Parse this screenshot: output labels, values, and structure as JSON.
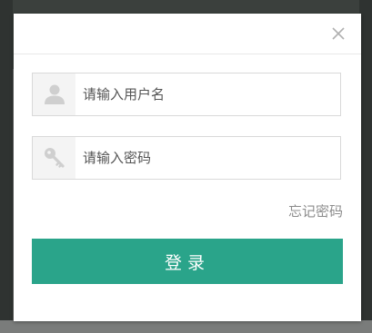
{
  "dialog": {
    "close_icon": "close-icon"
  },
  "username": {
    "placeholder": "请输入用户名",
    "value": "",
    "icon": "user-icon"
  },
  "password": {
    "placeholder": "请输入密码",
    "value": "",
    "icon": "key-icon"
  },
  "forgot_label": "忘记密码",
  "login_label": "登录",
  "colors": {
    "accent": "#2aa48a",
    "icon_gray": "#c4c4c4",
    "muted_text": "#8c8c8c"
  }
}
